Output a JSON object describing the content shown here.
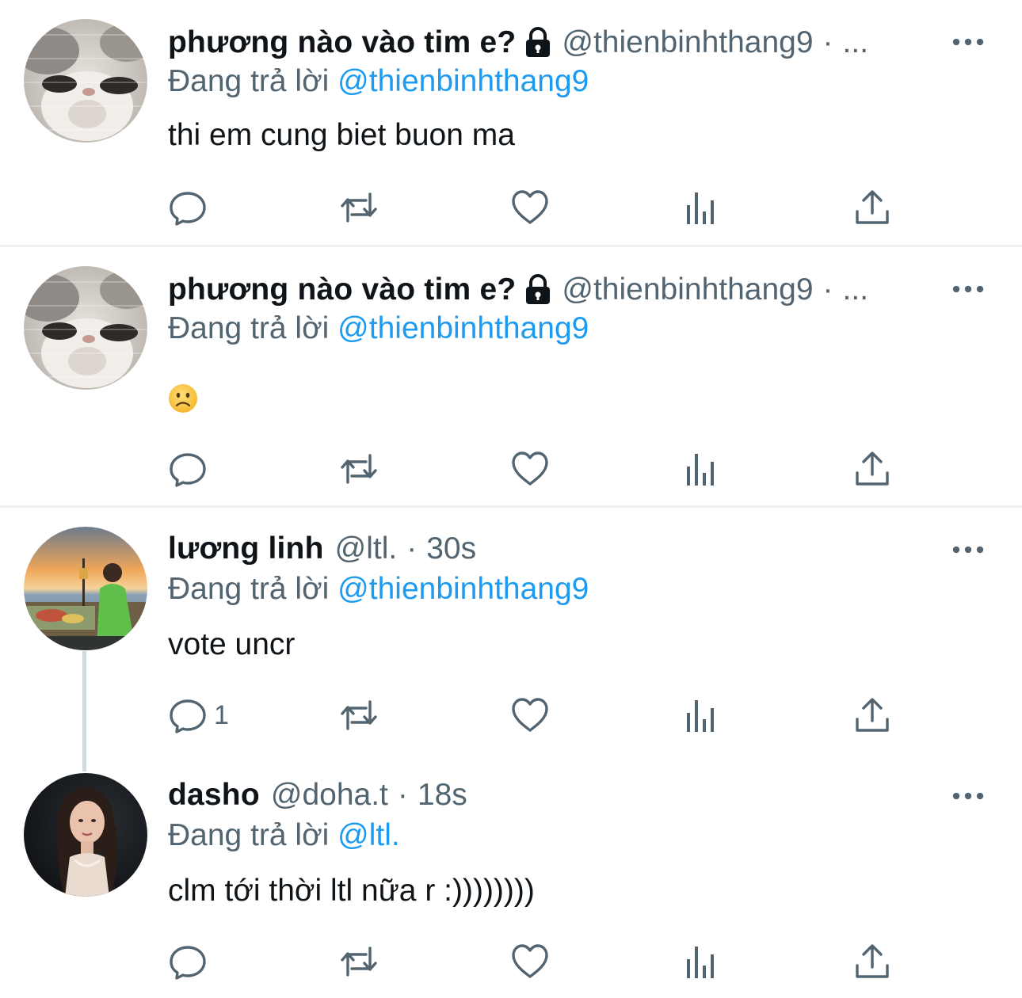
{
  "tweets": [
    {
      "name": "phương nào vào tim e?",
      "locked": true,
      "handle": "@thienbinhthang9",
      "separator": "·",
      "time": "...",
      "replying_prefix": "Đang trả lời",
      "replying_to": "@thienbinhthang9",
      "text": "thi em cung biet buon ma",
      "reply_count": ""
    },
    {
      "name": "phương nào vào tim e?",
      "locked": true,
      "handle": "@thienbinhthang9",
      "separator": "·",
      "time": "...",
      "replying_prefix": "Đang trả lời",
      "replying_to": "@thienbinhthang9",
      "text": "",
      "emoji": "slightly-frowning-face-emoji",
      "reply_count": ""
    },
    {
      "name": "lương linh",
      "locked": false,
      "handle": "@ltl.",
      "separator": "·",
      "time": "30s",
      "replying_prefix": "Đang trả lời",
      "replying_to": "@thienbinhthang9",
      "text": "vote uncr",
      "reply_count": "1"
    },
    {
      "name": "dasho",
      "locked": false,
      "handle": "@doha.t",
      "separator": "·",
      "time": "18s",
      "replying_prefix": "Đang trả lời",
      "replying_to": "@ltl.",
      "text": "clm tới thời ltl nữa r :))))))))",
      "reply_count": ""
    }
  ],
  "icons": {
    "reply": "reply-icon",
    "retweet": "retweet-icon",
    "like": "heart-icon",
    "views": "views-icon",
    "share": "share-icon",
    "more": "more-icon",
    "lock": "lock-icon"
  },
  "colors": {
    "text": "#0f1419",
    "secondary": "#536471",
    "link": "#1d9bf0",
    "divider": "#eff3f4",
    "thread_line": "#cfd9de"
  }
}
